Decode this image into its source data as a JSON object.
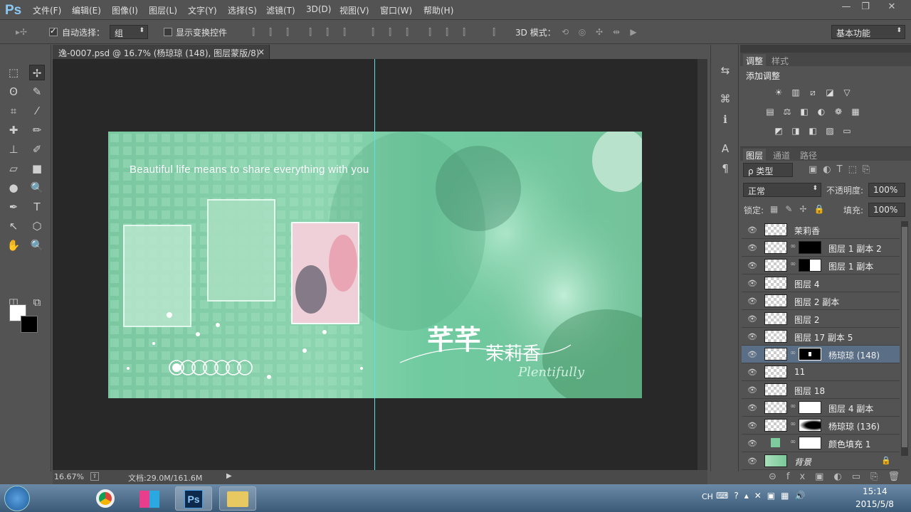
{
  "app": {
    "logo": "Ps"
  },
  "menu": [
    "文件(F)",
    "编辑(E)",
    "图像(I)",
    "图层(L)",
    "文字(Y)",
    "选择(S)",
    "滤镜(T)",
    "3D(D)",
    "视图(V)",
    "窗口(W)",
    "帮助(H)"
  ],
  "window_controls": {
    "minimize": "—",
    "restore": "❐",
    "close": "✕"
  },
  "options": {
    "auto_select_label": "自动选择：",
    "auto_select_value": "组",
    "show_transform_label": "显示变换控件",
    "mode3d_label": "3D 模式：",
    "workspace": "基本功能"
  },
  "document": {
    "tab_title": "逸-0007.psd @ 16.7% (杨琼琼 (148), 图层蒙版/8) *",
    "close": "×",
    "canvas_text_en": "Beautiful life means to share everything with you",
    "canvas_logo_cn": "茉莉香",
    "canvas_logo_script": "Plentifully"
  },
  "status": {
    "zoom": "16.67%",
    "doc": "文档:29.0M/161.6M"
  },
  "adjust_panel": {
    "tab_adjust": "调整",
    "tab_style": "样式",
    "title": "添加调整"
  },
  "layers_panel": {
    "tabs": [
      "图层",
      "通道",
      "路径"
    ],
    "filter": "ρ 类型",
    "blend_mode": "正常",
    "opacity_label": "不透明度:",
    "opacity": "100%",
    "lock_label": "锁定:",
    "fill_label": "填充:",
    "fill": "100%",
    "layers": [
      {
        "name": "茉莉香",
        "mask": false
      },
      {
        "name": "图层 1 副本 2",
        "mask": true
      },
      {
        "name": "图层 1 副本",
        "mask": true
      },
      {
        "name": "图层 4",
        "mask": false
      },
      {
        "name": "图层 2 副本",
        "mask": false
      },
      {
        "name": "图层 2",
        "mask": false
      },
      {
        "name": "图层 17 副本 5",
        "mask": false
      },
      {
        "name": "杨琼琼 (148)",
        "mask": true,
        "selected": true
      },
      {
        "name": "11",
        "mask": false
      },
      {
        "name": "图层 18",
        "mask": false
      },
      {
        "name": "图层 4 副本",
        "mask": true
      },
      {
        "name": "杨琼琼 (136)",
        "mask": true
      },
      {
        "name": "颜色填充 1",
        "mask": true
      },
      {
        "name": "背景",
        "mask": false,
        "italic": true
      }
    ]
  },
  "taskbar": {
    "lang": "CH",
    "time": "15:14",
    "date": "2015/5/8"
  }
}
